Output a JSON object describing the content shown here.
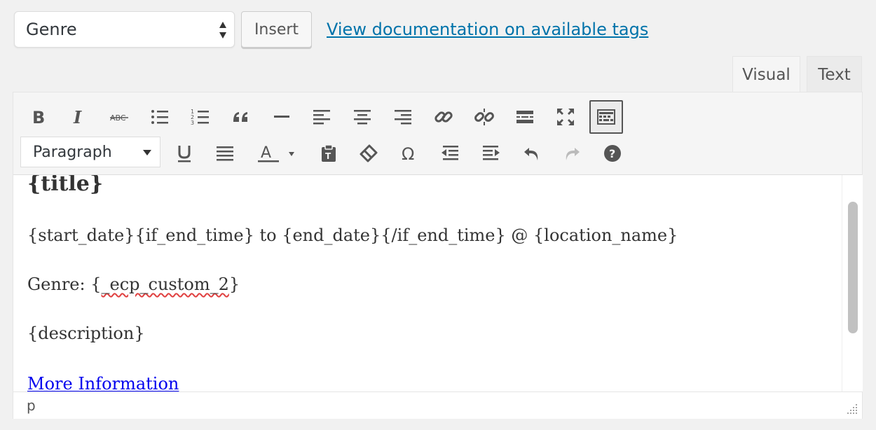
{
  "top": {
    "select_value": "Genre",
    "insert_label": "Insert",
    "doc_link": "View documentation on available tags"
  },
  "tabs": {
    "visual": "Visual",
    "text": "Text"
  },
  "toolbar": {
    "format_value": "Paragraph",
    "row1": [
      "bold-icon",
      "italic-icon",
      "strikethrough-icon",
      "bullet-list-icon",
      "numbered-list-icon",
      "blockquote-icon",
      "horizontal-line-icon",
      "align-left-icon",
      "align-center-icon",
      "align-right-icon",
      "link-icon",
      "unlink-icon",
      "read-more-icon",
      "fullscreen-icon",
      "toolbar-toggle-icon"
    ],
    "row2": [
      "underline-icon",
      "justify-icon",
      "text-color-icon",
      "paste-text-icon",
      "clear-formatting-icon",
      "special-character-icon",
      "outdent-icon",
      "indent-icon",
      "undo-icon",
      "redo-icon",
      "help-icon"
    ]
  },
  "content": {
    "title": "{title}",
    "line1": "{start_date}{if_end_time} to {end_date}{/if_end_time} @ {location_name}",
    "line2_prefix": "Genre: {",
    "line2_spell": "_ecp_custom_2",
    "line2_suffix": "}",
    "line3": "{description}",
    "line4": "More Information"
  },
  "status": {
    "path": "p"
  },
  "colors": {
    "link": "#0073aa",
    "content_link": "#0000ee",
    "spell_error": "#e04040"
  }
}
